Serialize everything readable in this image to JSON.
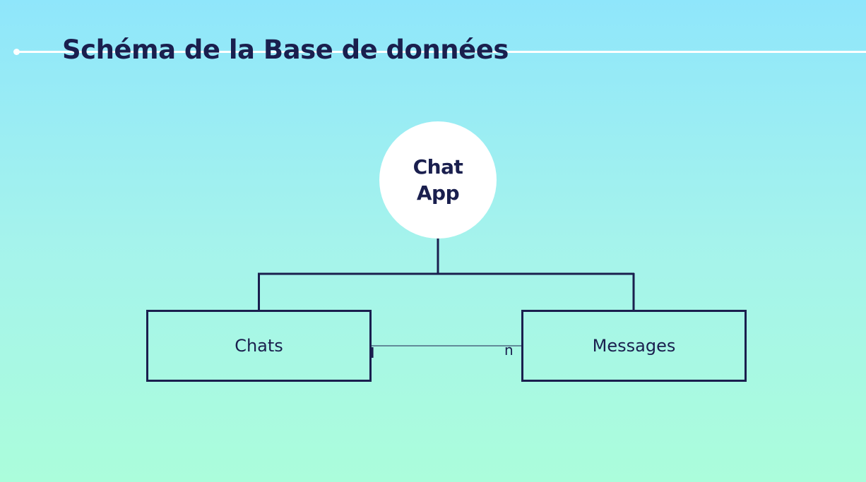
{
  "slide": {
    "title": "Schéma de la Base de données"
  },
  "diagram": {
    "root": {
      "label": "Chat App"
    },
    "entities": [
      {
        "label": "Chats"
      },
      {
        "label": "Messages"
      }
    ],
    "relationship": {
      "left_cardinality": "I",
      "right_cardinality": "n"
    }
  },
  "colors": {
    "ink": "#1a1f4e",
    "background_top": "#8fe6fb",
    "background_bottom": "#abfddb",
    "node_fill": "#ffffff"
  }
}
